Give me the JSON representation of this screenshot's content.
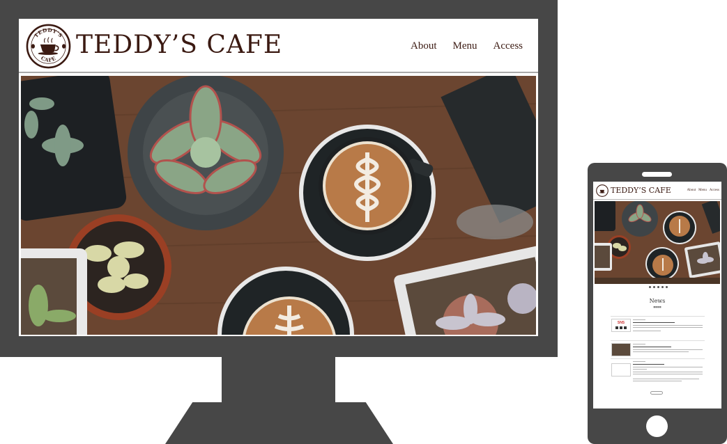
{
  "site": {
    "title": "TEDDY’S  CAFE",
    "logo_text_top": "TEDDY'S",
    "logo_text_bottom": "CAFE"
  },
  "nav": {
    "items": [
      {
        "label": "About"
      },
      {
        "label": "Menu"
      },
      {
        "label": "Access"
      }
    ]
  },
  "mobile": {
    "title": "TEDDY’S CAFE",
    "nav": [
      "About",
      "Menu",
      "Access"
    ],
    "news_heading": "News",
    "thumb_label": "SNS"
  },
  "colors": {
    "device_gray": "#474747",
    "brand_brown": "#3b1a12",
    "table_wood": "#6b4530"
  }
}
